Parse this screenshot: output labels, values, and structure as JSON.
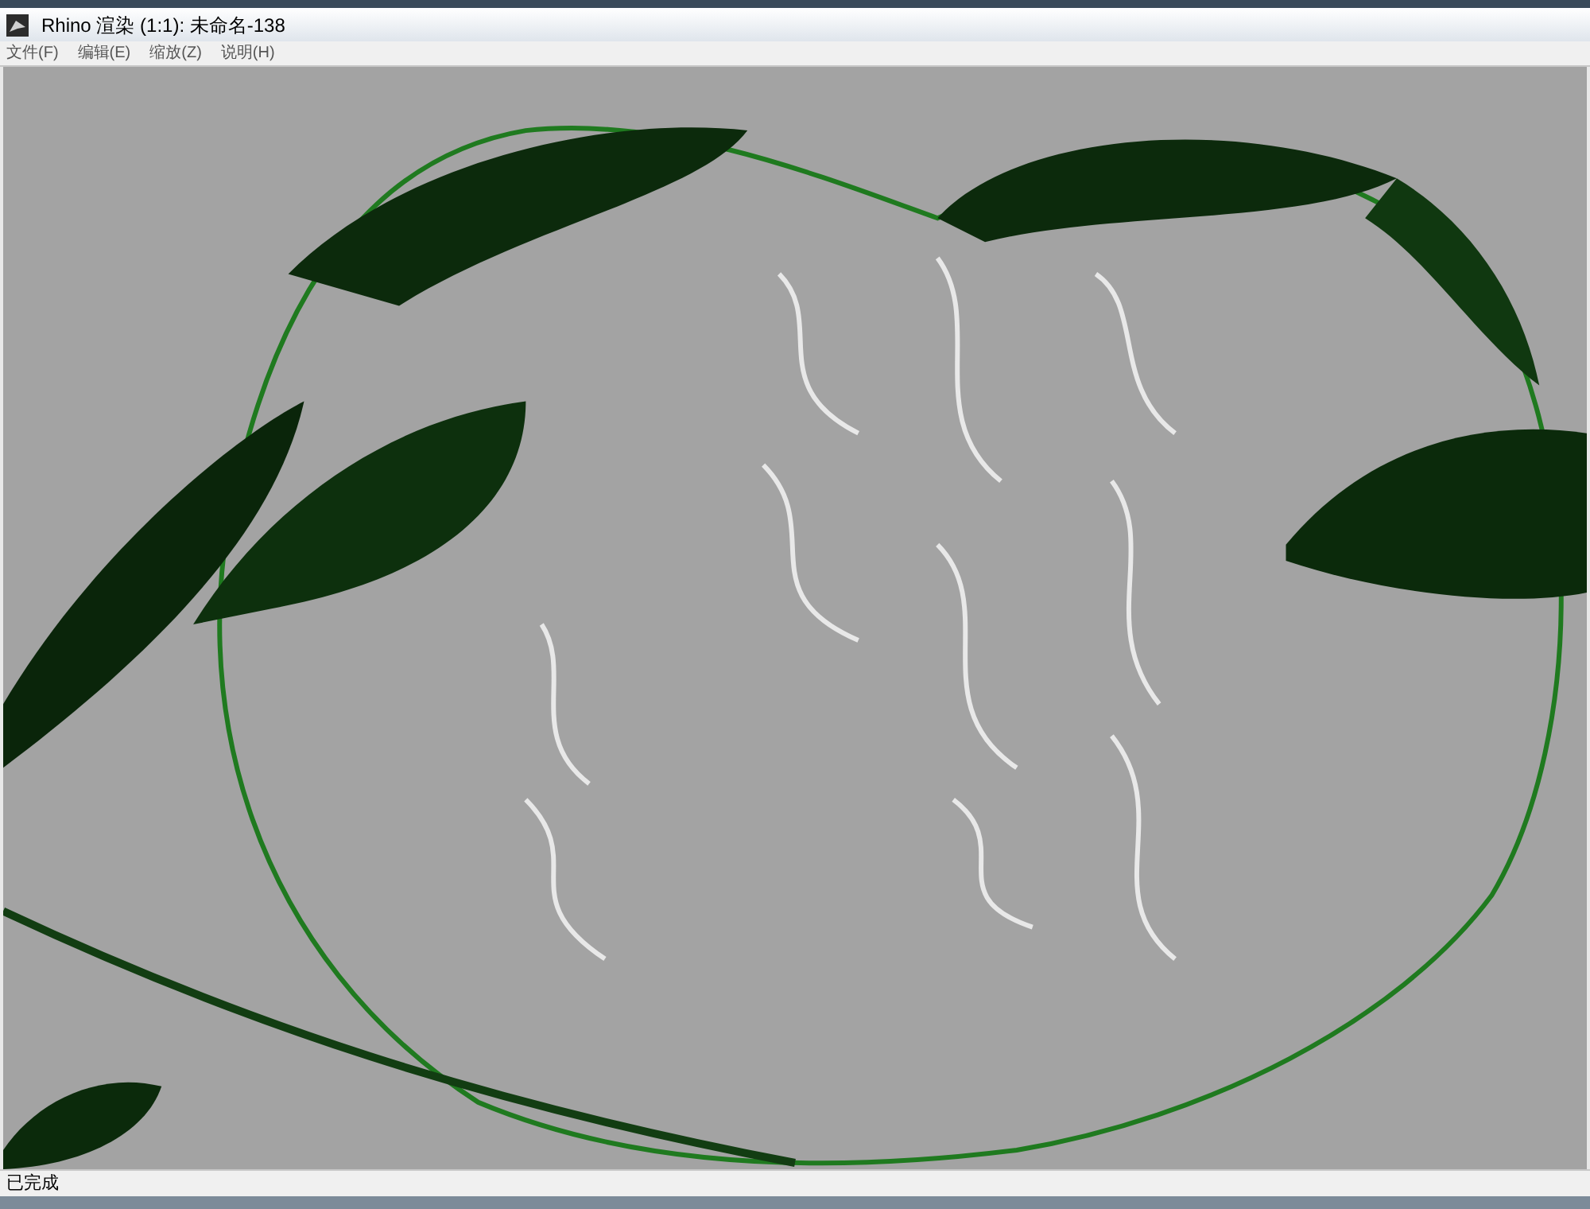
{
  "window": {
    "title": "Rhino 渲染 (1:1): 未命名-138"
  },
  "menu": [
    {
      "label": "文件(F)"
    },
    {
      "label": "编辑(E)"
    },
    {
      "label": "缩放(Z)"
    },
    {
      "label": "说明(H)"
    }
  ],
  "status_bar": {
    "text": "已完成"
  }
}
